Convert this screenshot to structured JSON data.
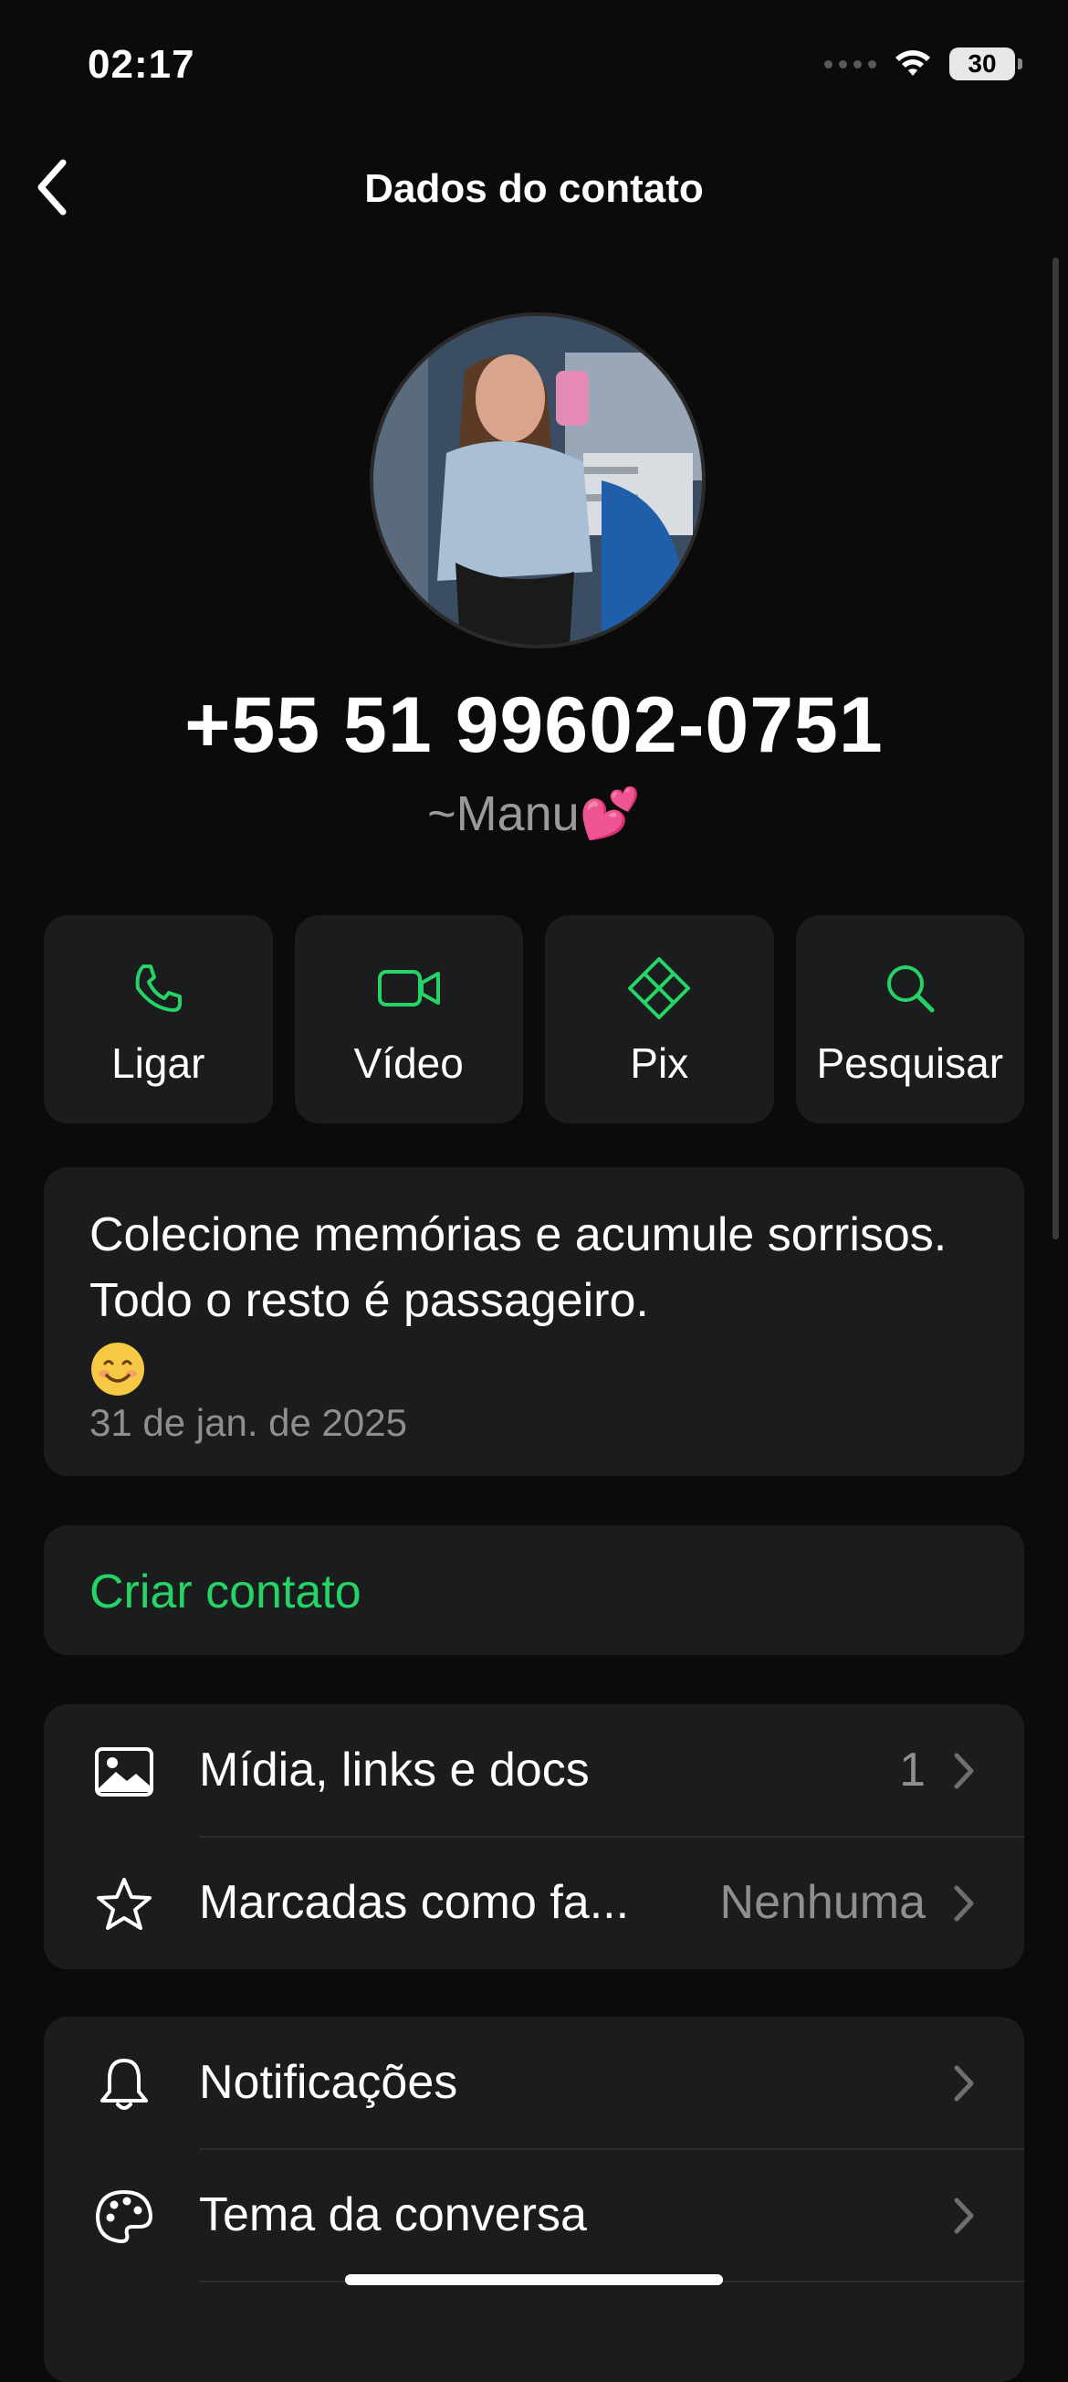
{
  "status": {
    "time": "02:17",
    "battery": "30"
  },
  "nav": {
    "title": "Dados do contato"
  },
  "contact": {
    "phone": "+55 51 99602-0751",
    "nickname": "~Manu💕"
  },
  "actions": [
    {
      "label": "Ligar",
      "icon": "phone-icon"
    },
    {
      "label": "Vídeo",
      "icon": "video-icon"
    },
    {
      "label": "Pix",
      "icon": "pix-icon"
    },
    {
      "label": "Pesquisar",
      "icon": "search-icon"
    }
  ],
  "about": {
    "text": "Colecione memórias e acumule sorrisos. Todo o resto é passageiro.",
    "date": "31 de jan. de 2025"
  },
  "create_contact": {
    "label": "Criar contato"
  },
  "media_list": [
    {
      "label": "Mídia, links e docs",
      "value": "1",
      "icon": "image-icon"
    },
    {
      "label": "Marcadas como fa...",
      "value": "Nenhuma",
      "icon": "star-icon"
    }
  ],
  "settings_list": [
    {
      "label": "Notificações",
      "icon": "bell-icon"
    },
    {
      "label": "Tema da conversa",
      "icon": "palette-icon"
    }
  ],
  "colors": {
    "accent": "#25d366",
    "background": "#0b0b0b",
    "card": "#1b1c1d",
    "secondary_text": "#8f8f8f"
  }
}
